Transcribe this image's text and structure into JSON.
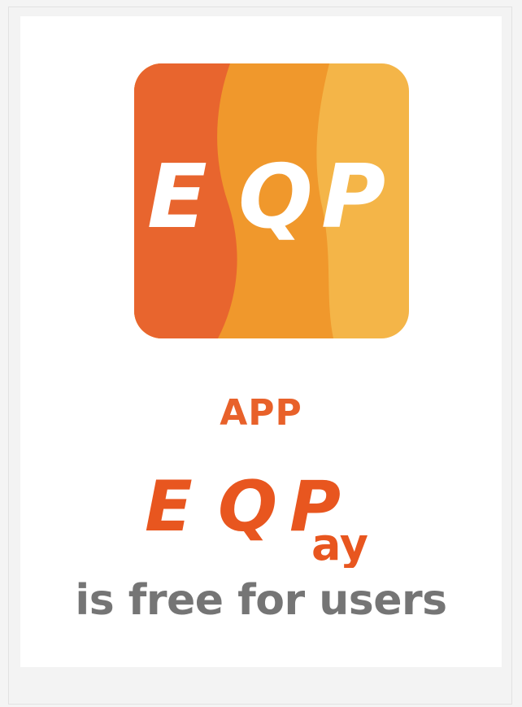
{
  "app_icon": {
    "letters": [
      "E",
      "Q",
      "P"
    ],
    "colors": {
      "band_left": "#e8652e",
      "band_middle": "#f0982c",
      "band_right": "#f4b548",
      "letters": "#ffffff"
    }
  },
  "headline": {
    "app_label": "APP"
  },
  "brand": {
    "letters": [
      "E",
      "Q",
      "P"
    ],
    "suffix": "ay",
    "color": "#e8561f"
  },
  "tagline": "is free for users",
  "colors": {
    "accent": "#e8612a",
    "tagline": "#757575",
    "background": "#ffffff"
  }
}
